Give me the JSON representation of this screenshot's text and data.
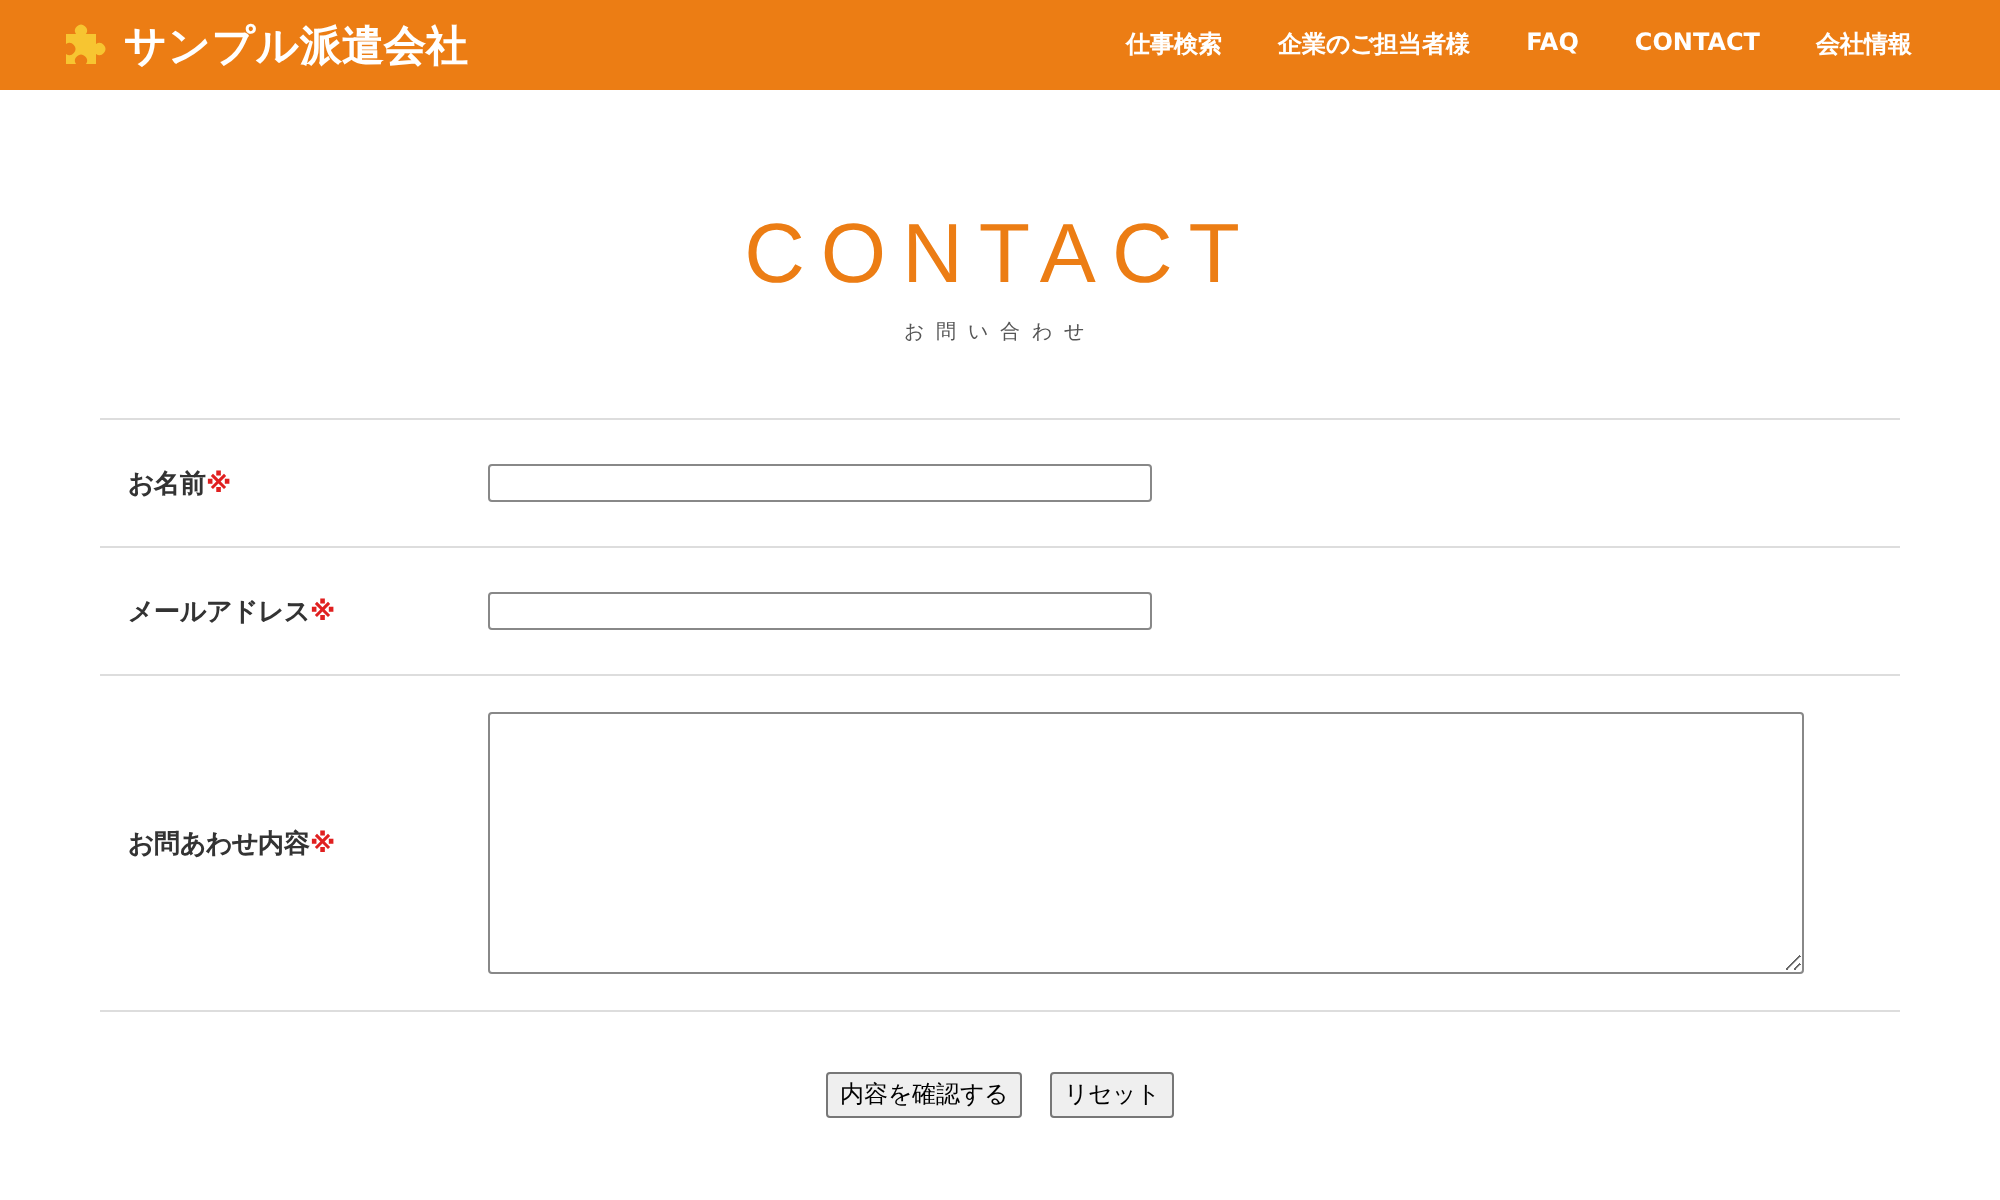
{
  "header": {
    "logo_text": "サンプル派遣会社",
    "nav": [
      {
        "label": "仕事検索"
      },
      {
        "label": "企業のご担当者様"
      },
      {
        "label": "FAQ"
      },
      {
        "label": "CONTACT"
      },
      {
        "label": "会社情報"
      }
    ]
  },
  "heading": {
    "title": "CONTACT",
    "subtitle": "お問い合わせ"
  },
  "form": {
    "rows": [
      {
        "kind": "input",
        "label": "お名前",
        "required_mark": "※"
      },
      {
        "kind": "input",
        "label": "メールアドレス",
        "required_mark": "※"
      },
      {
        "kind": "textarea",
        "label": "お問あわせ内容",
        "required_mark": "※"
      }
    ],
    "buttons": [
      {
        "label": "内容を確認する"
      },
      {
        "label": "リセット"
      }
    ]
  }
}
